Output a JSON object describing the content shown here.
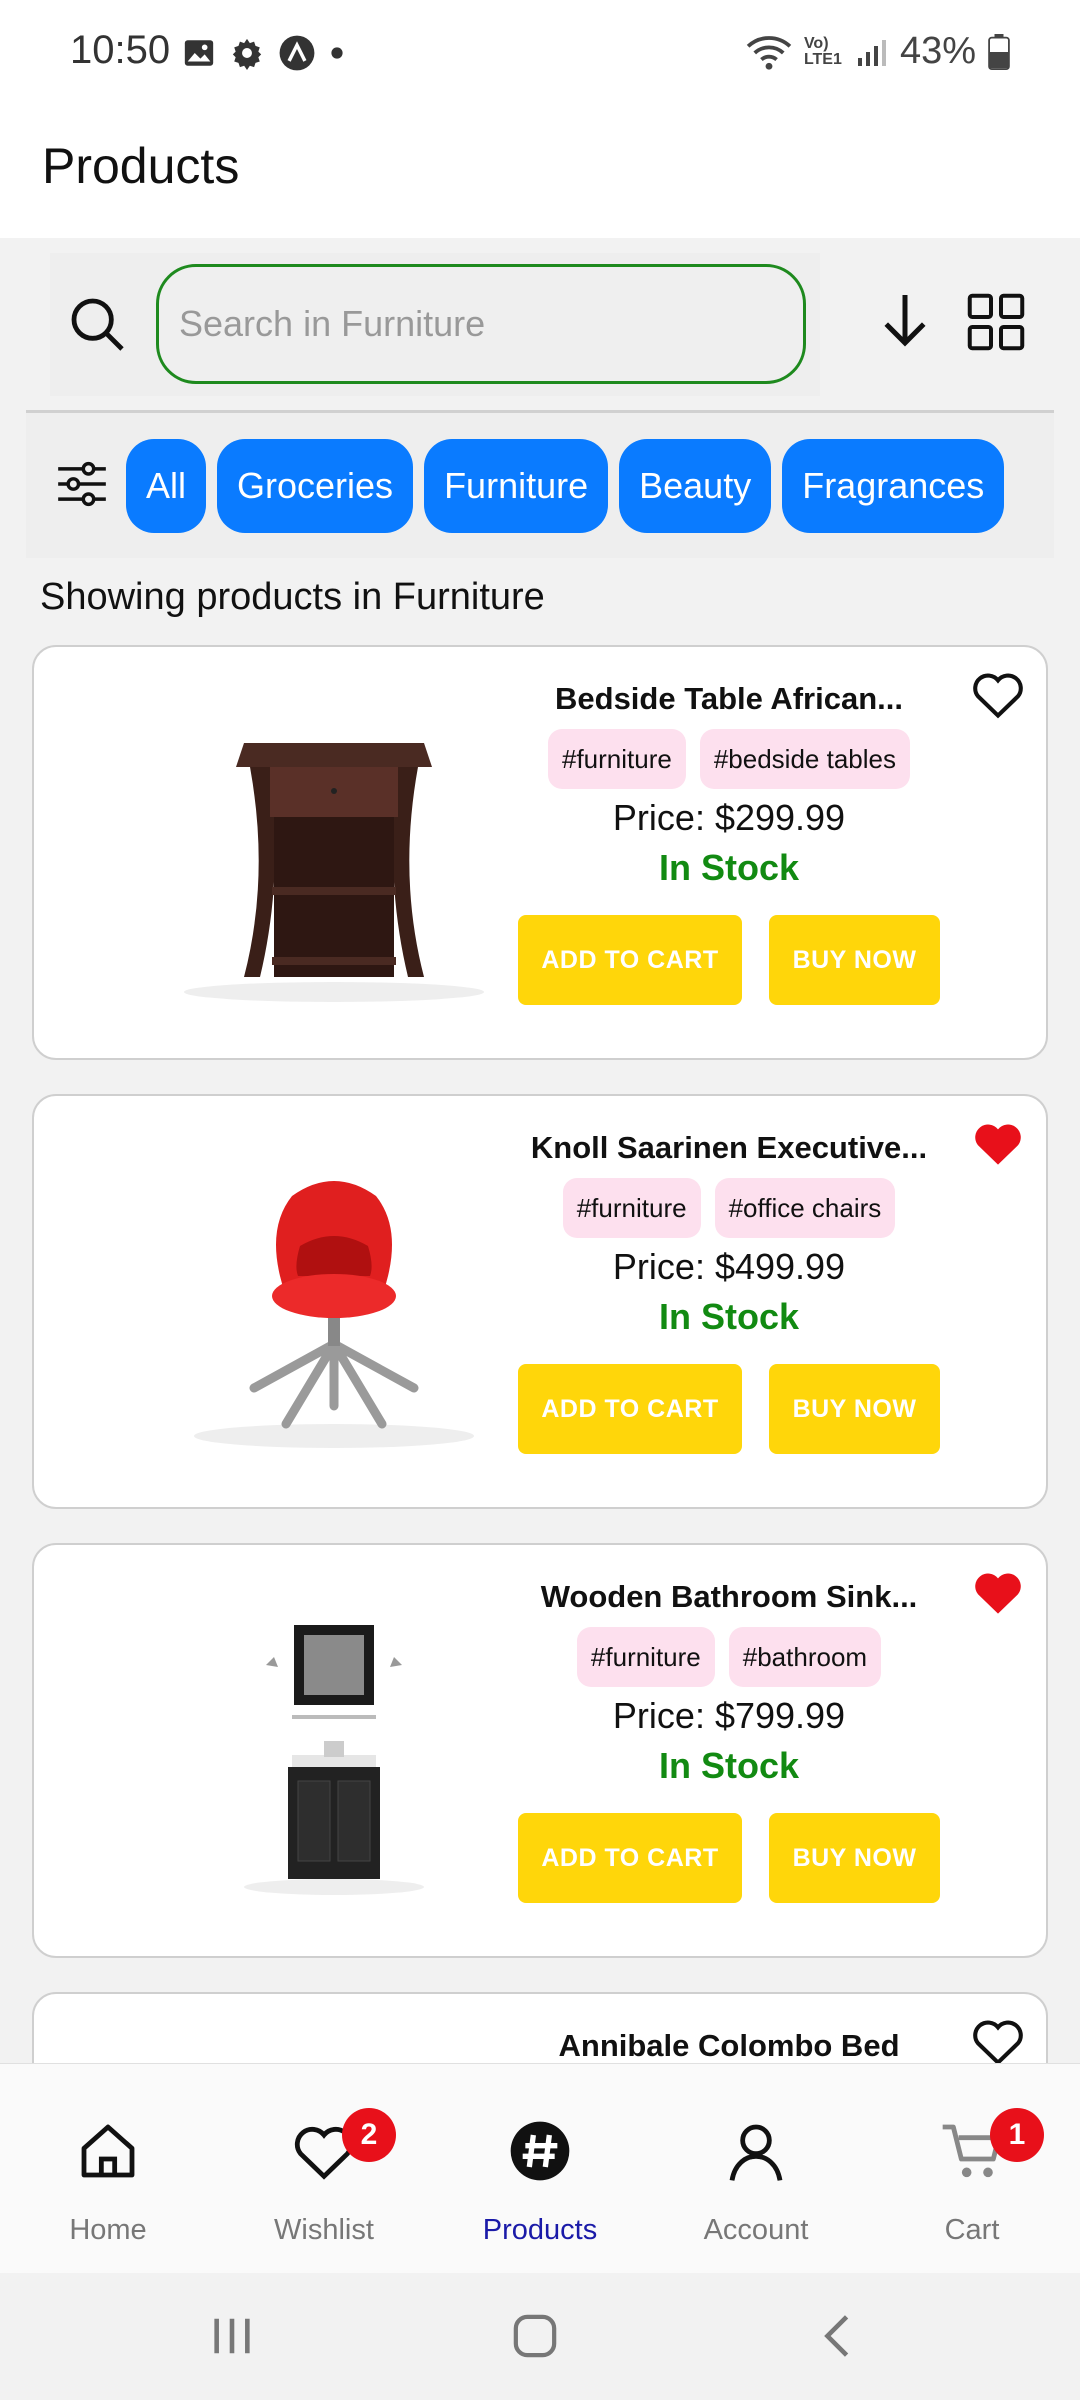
{
  "status_bar": {
    "time": "10:50",
    "battery": "43%",
    "network": "Vo) LTE1"
  },
  "header": {
    "title": "Products"
  },
  "search": {
    "placeholder": "Search in Furniture",
    "value": ""
  },
  "categories": [
    "All",
    "Groceries",
    "Furniture",
    "Beauty",
    "Fragrances"
  ],
  "showing_text": "Showing products in Furniture",
  "products": [
    {
      "title": "Bedside Table African...",
      "tags": [
        "#furniture",
        "#bedside tables"
      ],
      "price": "Price: $299.99",
      "stock": "In Stock",
      "add_to_cart": "ADD TO CART",
      "buy_now": "BUY NOW",
      "favorited": false,
      "image": "bedside-table"
    },
    {
      "title": "Knoll Saarinen Executive...",
      "tags": [
        "#furniture",
        "#office chairs"
      ],
      "price": "Price: $499.99",
      "stock": "In Stock",
      "add_to_cart": "ADD TO CART",
      "buy_now": "BUY NOW",
      "favorited": true,
      "image": "office-chair"
    },
    {
      "title": "Wooden Bathroom Sink...",
      "tags": [
        "#furniture",
        "#bathroom"
      ],
      "price": "Price: $799.99",
      "stock": "In Stock",
      "add_to_cart": "ADD TO CART",
      "buy_now": "BUY NOW",
      "favorited": true,
      "image": "bathroom-sink"
    },
    {
      "title": "Annibale Colombo Bed",
      "favorited": false
    }
  ],
  "bottom_nav": {
    "items": [
      {
        "label": "Home",
        "icon": "home-icon"
      },
      {
        "label": "Wishlist",
        "icon": "heart-icon",
        "badge": "2"
      },
      {
        "label": "Products",
        "icon": "hashtag-icon",
        "active": true
      },
      {
        "label": "Account",
        "icon": "user-icon"
      },
      {
        "label": "Cart",
        "icon": "cart-icon",
        "badge": "1"
      }
    ]
  },
  "colors": {
    "accent": "#0a7bff",
    "button": "#ffd60a",
    "in_stock": "#128a12",
    "favorite": "#e8101a",
    "tag_bg": "#fde0ee",
    "active_nav": "#1a1aa8"
  }
}
